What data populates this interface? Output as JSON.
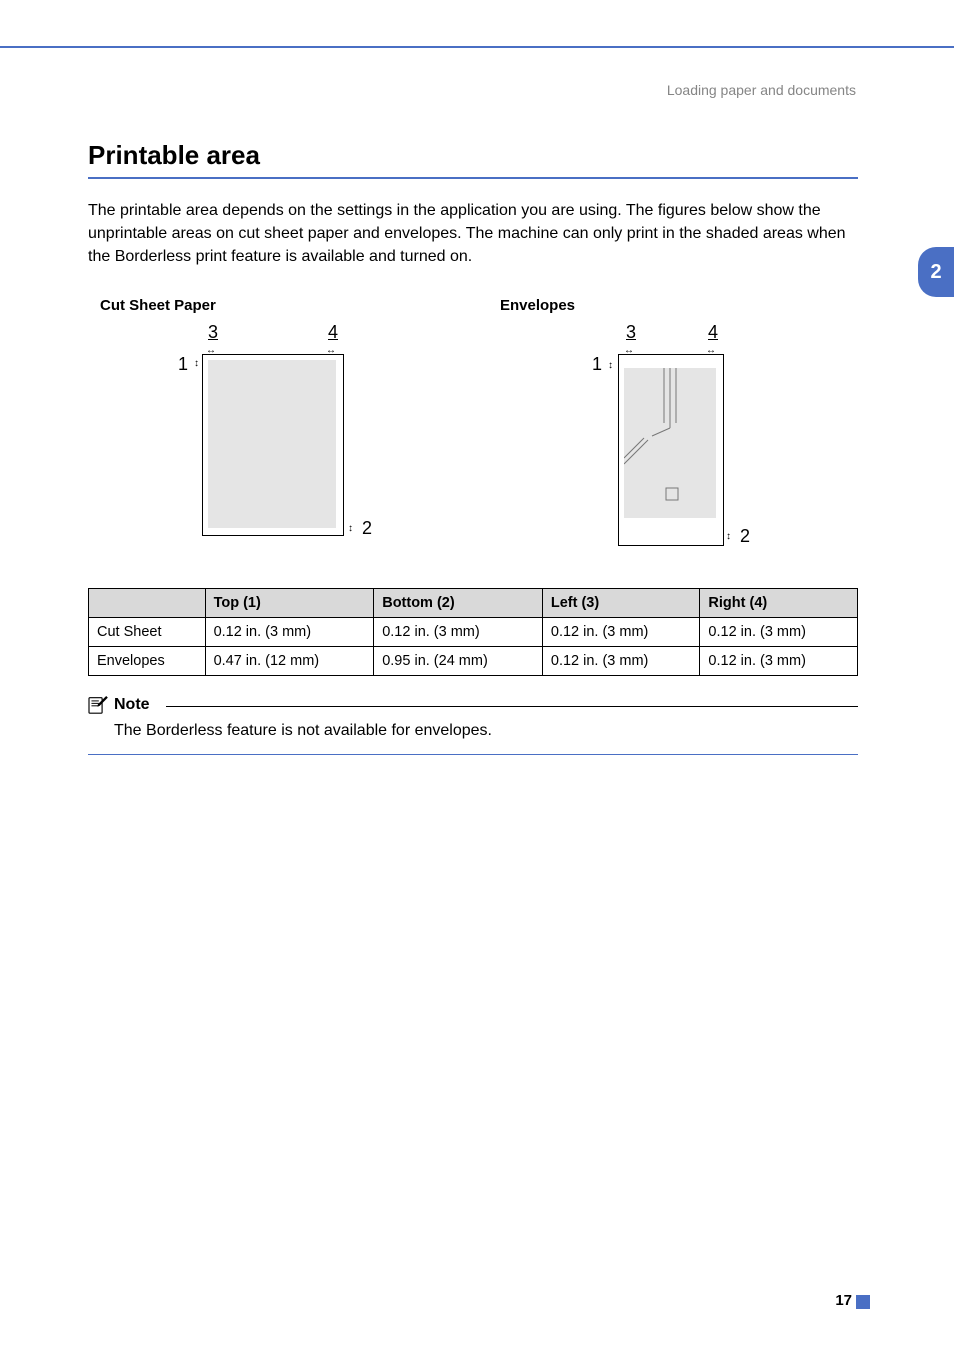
{
  "header": {
    "breadcrumb": "Loading paper and documents"
  },
  "side_tab": {
    "chapter": "2"
  },
  "section": {
    "title": "Printable area",
    "intro": "The printable area depends on the settings in the application you are using. The figures below show the unprintable areas on cut sheet paper and envelopes. The machine can only print in the shaded areas when the Borderless print feature is available and turned on."
  },
  "figures": {
    "cut_sheet_title": "Cut Sheet Paper",
    "envelopes_title": "Envelopes",
    "labels": {
      "one": "1",
      "two": "2",
      "three": "3",
      "four": "4"
    }
  },
  "table": {
    "headers": {
      "top": "Top (1)",
      "bottom": "Bottom (2)",
      "left": "Left (3)",
      "right": "Right (4)"
    },
    "rows": [
      {
        "name": "Cut Sheet",
        "top": "0.12 in. (3 mm)",
        "bottom": "0.12 in. (3 mm)",
        "left": "0.12 in. (3 mm)",
        "right": "0.12 in. (3 mm)"
      },
      {
        "name": "Envelopes",
        "top": "0.47 in. (12 mm)",
        "bottom": "0.95 in. (24 mm)",
        "left": "0.12 in. (3 mm)",
        "right": "0.12 in. (3 mm)"
      }
    ]
  },
  "note": {
    "title": "Note",
    "text": "The Borderless feature is not available for envelopes."
  },
  "footer": {
    "page": "17"
  }
}
